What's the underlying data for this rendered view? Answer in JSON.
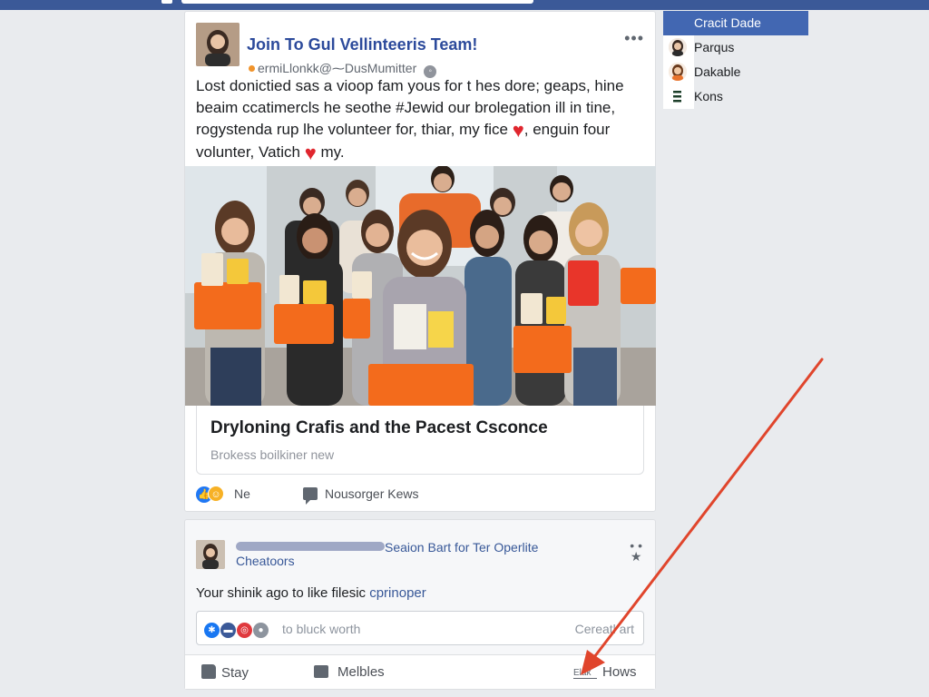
{
  "post": {
    "title": "Join To Gul Vellinteeris Team!",
    "handle": "ermiLlonkk@⁓DusMumitter",
    "more": "•••",
    "body_line1": "Lost donictied sas a vioop fam yous for t hes dore;  geaps, hine",
    "body_line2": "beaim ccatimercls he seothe #Jewid our brolegation ill in tine,",
    "body_line3": "rogystenda rup lhe volunteer for, thiar, my fice",
    "body_line3_after": ", enguin four",
    "body_line4": "volunter, Vatich",
    "body_line4_after": "my.",
    "heart": "♥",
    "link_title": "Dryloning Crafis and the Pacest Csconce",
    "link_subtitle": "Brokess boilkiner new",
    "reactions_count": "Ne",
    "comments_label": "Nousorger Kews"
  },
  "post2": {
    "title": "Seaion Bart for Ter Operlite",
    "subtitle": "Cheatoors",
    "menu_dots": "• •",
    "menu_star": "★",
    "text_prefix": "Your shinik ago to like filesic ",
    "text_accent": "cprinoper",
    "comment_placeholder": "to bluck worth",
    "comment_action": "Cereatl art",
    "action_like": "Stay",
    "action_comment": "Melbles",
    "action_share_icon": "Elak",
    "action_share": "Hows"
  },
  "sidebar": {
    "header": "Cracit Dade",
    "items": [
      {
        "label": "Parqus"
      },
      {
        "label": "Dakable"
      },
      {
        "label": "Kons"
      }
    ]
  },
  "colors": {
    "topbar": "#3b5998",
    "title_blue": "#2c4a9b",
    "heart_red": "#e0262e",
    "arrow_red": "#e0452c",
    "sidebar_header": "#4267b2"
  }
}
